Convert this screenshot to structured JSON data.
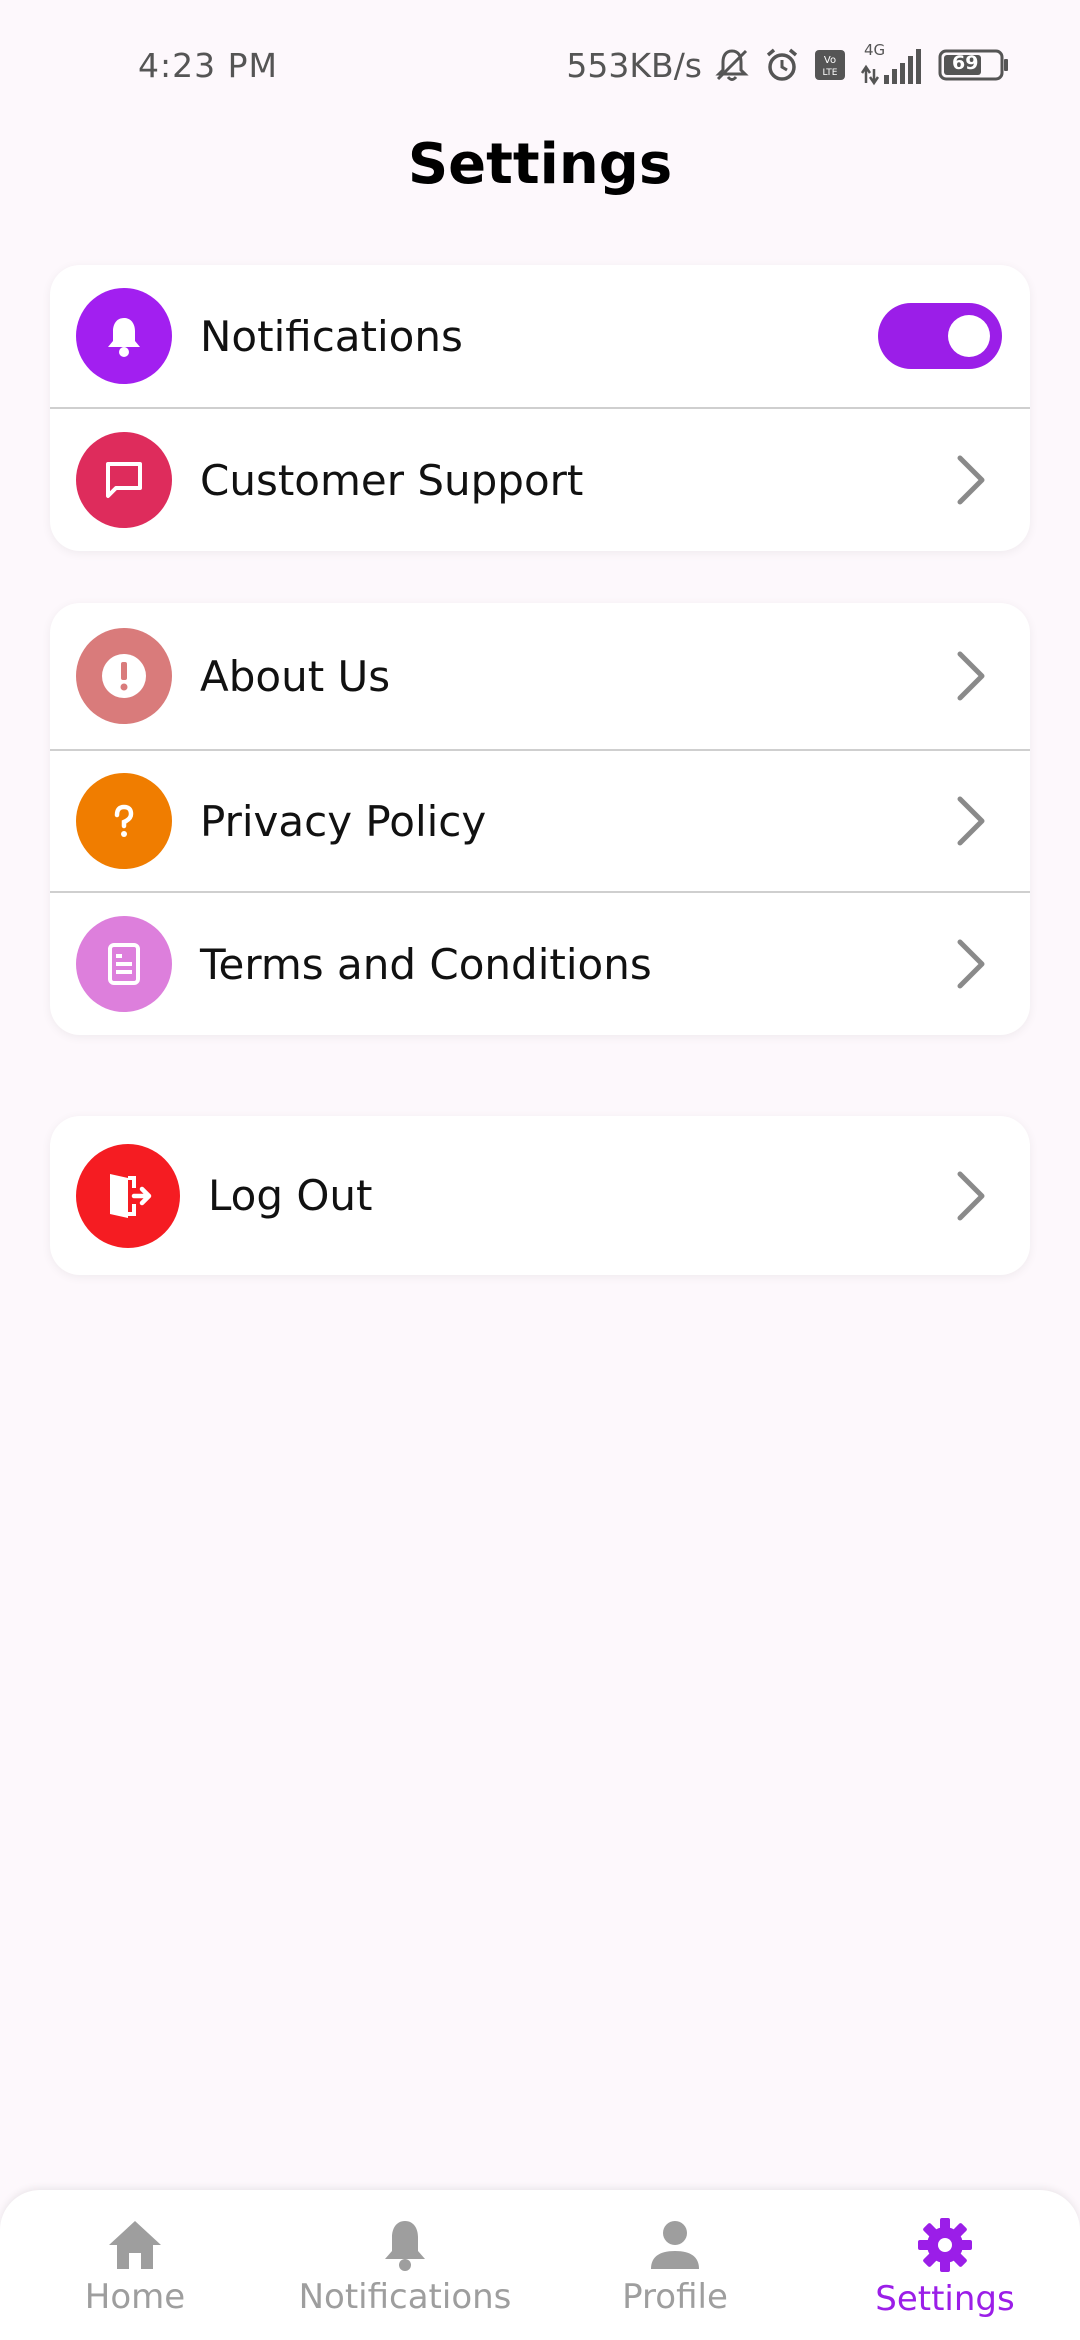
{
  "status_bar": {
    "time": "4:23 PM",
    "network_speed": "553KB/s",
    "signal_label": "4G",
    "battery_level": "69",
    "icons": [
      "mute-bell-icon",
      "alarm-icon",
      "volte-icon",
      "signal-icon",
      "battery-icon"
    ]
  },
  "page": {
    "title": "Settings"
  },
  "colors": {
    "accent": "#9b1ee8",
    "notifications_icon": "#a21ff0",
    "customer_support_icon": "#de2c5c",
    "about_icon": "#d97b7b",
    "privacy_icon": "#f07d00",
    "terms_icon": "#dd7fdc",
    "logout_icon": "#f51c22",
    "nav_inactive": "#9e9e9e"
  },
  "group1": {
    "notifications": {
      "label": "Notifications",
      "icon": "bell-icon",
      "enabled": true
    },
    "customer_support": {
      "label": "Customer Support",
      "icon": "chat-icon"
    }
  },
  "group2": {
    "about": {
      "label": "About Us",
      "icon": "exclamation-icon"
    },
    "privacy": {
      "label": "Privacy Policy",
      "icon": "question-icon"
    },
    "terms": {
      "label": "Terms and Conditions",
      "icon": "document-icon"
    }
  },
  "group3": {
    "logout": {
      "label": "Log Out",
      "icon": "logout-door-icon"
    }
  },
  "bottom_nav": {
    "items": [
      {
        "label": "Home",
        "icon": "home-icon",
        "active": false
      },
      {
        "label": "Notifications",
        "icon": "bell-icon",
        "active": false
      },
      {
        "label": "Profile",
        "icon": "person-icon",
        "active": false
      },
      {
        "label": "Settings",
        "icon": "gear-icon",
        "active": true
      }
    ]
  }
}
